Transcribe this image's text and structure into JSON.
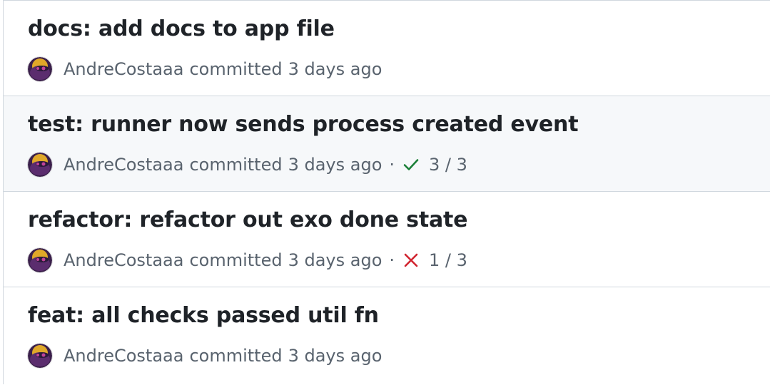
{
  "commits": [
    {
      "title": "docs: add docs to app file",
      "author": "AndreCostaaa",
      "verb": "committed",
      "time": "3 days ago",
      "checks": null
    },
    {
      "title": "test: runner now sends process created event",
      "author": "AndreCostaaa",
      "verb": "committed",
      "time": "3 days ago",
      "checks": {
        "status": "success",
        "icon": "check-icon",
        "count": "3 / 3",
        "color": "#1a7f37"
      }
    },
    {
      "title": "refactor: refactor out exo done state",
      "author": "AndreCostaaa",
      "verb": "committed",
      "time": "3 days ago",
      "checks": {
        "status": "failure",
        "icon": "x-icon",
        "count": "1 / 3",
        "color": "#d1242f"
      }
    },
    {
      "title": "feat: all checks passed util fn",
      "author": "AndreCostaaa",
      "verb": "committed",
      "time": "3 days ago",
      "checks": null
    }
  ],
  "separator": "·",
  "colors": {
    "border": "#d0d7de",
    "row_hover_bg": "#f6f8fa",
    "muted_text": "#59636e",
    "title_text": "#1f2328"
  }
}
